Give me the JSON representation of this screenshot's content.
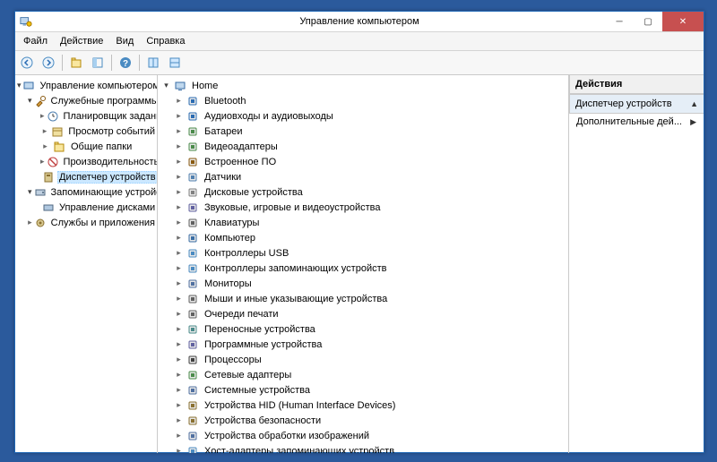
{
  "window": {
    "title": "Управление компьютером"
  },
  "menu": {
    "file": "Файл",
    "action": "Действие",
    "view": "Вид",
    "help": "Справка"
  },
  "leftTree": {
    "root": "Управление компьютером (л",
    "n1": "Служебные программы",
    "n1a": "Планировщик заданий",
    "n1b": "Просмотр событий",
    "n1c": "Общие папки",
    "n1d": "Производительность",
    "n1e": "Диспетчер устройств",
    "n2": "Запоминающие устройст",
    "n2a": "Управление дисками",
    "n3": "Службы и приложения"
  },
  "deviceTree": {
    "root": "Home",
    "items": [
      "Bluetooth",
      "Аудиовходы и аудиовыходы",
      "Батареи",
      "Видеоадаптеры",
      "Встроенное ПО",
      "Датчики",
      "Дисковые устройства",
      "Звуковые, игровые и видеоустройства",
      "Клавиатуры",
      "Компьютер",
      "Контроллеры USB",
      "Контроллеры запоминающих устройств",
      "Мониторы",
      "Мыши и иные указывающие устройства",
      "Очереди печати",
      "Переносные устройства",
      "Программные устройства",
      "Процессоры",
      "Сетевые адаптеры",
      "Системные устройства",
      "Устройства HID (Human Interface Devices)",
      "Устройства безопасности",
      "Устройства обработки изображений",
      "Хост-адаптеры запоминающих устройств"
    ]
  },
  "actions": {
    "header": "Действия",
    "sub": "Диспетчер устройств",
    "more": "Дополнительные дей..."
  }
}
